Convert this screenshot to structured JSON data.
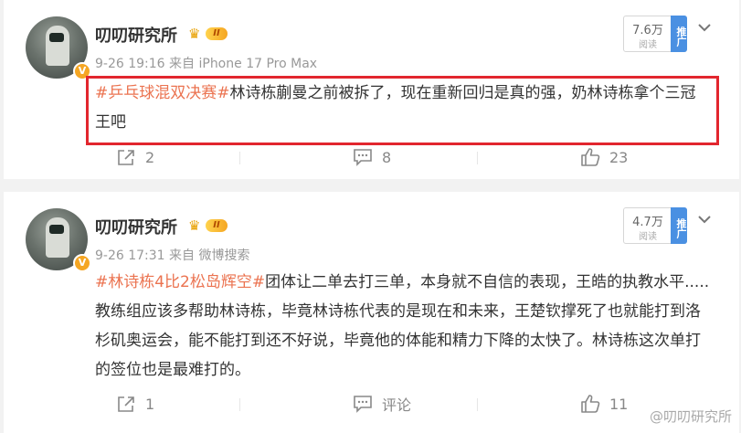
{
  "posts": [
    {
      "username": "叨叨研究所",
      "level": "II",
      "verified_mark": "V",
      "timestamp": "9-26 19:16",
      "source": "来自 iPhone 17 Pro Max",
      "reads": "7.6万",
      "reads_label": "阅读",
      "promote_label": "推广",
      "hashtag": "#乒乓球混双决赛#",
      "text": "林诗栋蒯曼之前被拆了，现在重新回归是真的强，奶林诗栋拿个三冠王吧",
      "actions": {
        "share": "2",
        "comment": "8",
        "like": "23"
      }
    },
    {
      "username": "叨叨研究所",
      "level": "II",
      "verified_mark": "V",
      "timestamp": "9-26 17:31",
      "source": "来自 微博搜索",
      "reads": "4.7万",
      "reads_label": "阅读",
      "promote_label": "推广",
      "hashtag": "#林诗栋4比2松岛辉空#",
      "text": "团体让二单去打三单，本身就不自信的表现，王皓的执教水平.....教练组应该多帮助林诗栋，毕竟林诗栋代表的是现在和未来，王楚钦撑死了也就能打到洛杉矶奥运会，能不能打到还不好说，毕竟他的体能和精力下降的太快了。林诗栋这次单打的签位也是最难打的。",
      "actions": {
        "share": "1",
        "comment": "评论",
        "like": "11"
      }
    }
  ],
  "watermark": "@叨叨研究所",
  "colors": {
    "tag": "#eb7350",
    "highlight": "#e2262e",
    "promote": "#4a90e2",
    "badge": "#f5a623"
  },
  "icons": [
    "share-icon",
    "comment-icon",
    "like-icon",
    "chevron-down-icon",
    "crown-icon"
  ]
}
